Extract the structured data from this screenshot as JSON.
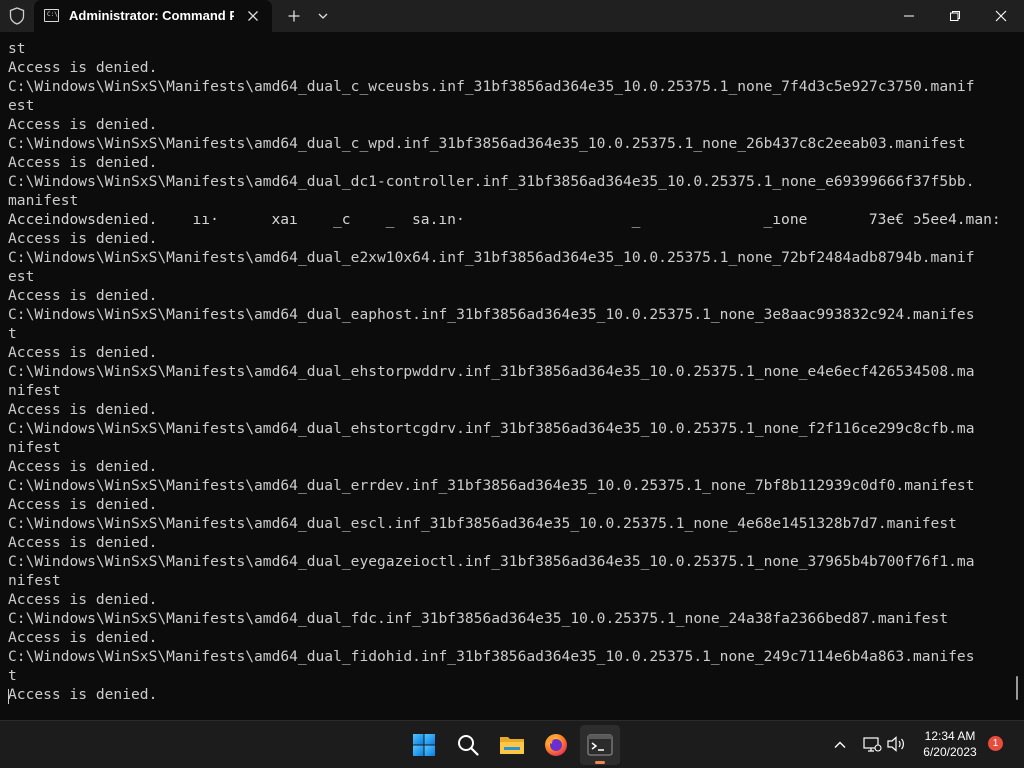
{
  "window": {
    "tab_title": "Administrator:  Command Prompt",
    "tab_icon_text": "C:\\",
    "new_tab_symbol": "+",
    "icons": [
      "shield-icon",
      "cmd-icon",
      "close-tab-icon",
      "new-tab-icon",
      "chevron-down-icon",
      "minimize-icon",
      "maximize-icon",
      "close-icon"
    ]
  },
  "terminal": {
    "lines": [
      "st",
      "Access is denied.",
      "C:\\Windows\\WinSxS\\Manifests\\amd64_dual_c_wceusbs.inf_31bf3856ad364e35_10.0.25375.1_none_7f4d3c5e927c3750.manif",
      "est",
      "Access is denied.",
      "C:\\Windows\\WinSxS\\Manifests\\amd64_dual_c_wpd.inf_31bf3856ad364e35_10.0.25375.1_none_26b437c8c2eeab03.manifest",
      "Access is denied.",
      "C:\\Windows\\WinSxS\\Manifests\\amd64_dual_dc1-controller.inf_31bf3856ad364e35_10.0.25375.1_none_e69399666f37f5bb.",
      "manifest",
      "Acceindowsdenied.    ıı·      ⅹaı    _c    _  sa.ın·                   _              _ıone       73e€ ɔ5ee4.man: es",
      "Access is denied.",
      "C:\\Windows\\WinSxS\\Manifests\\amd64_dual_e2xw10x64.inf_31bf3856ad364e35_10.0.25375.1_none_72bf2484adb8794b.manif",
      "est",
      "Access is denied.",
      "C:\\Windows\\WinSxS\\Manifests\\amd64_dual_eaphost.inf_31bf3856ad364e35_10.0.25375.1_none_3e8aac993832c924.manifes",
      "t",
      "Access is denied.",
      "C:\\Windows\\WinSxS\\Manifests\\amd64_dual_ehstorpwddrv.inf_31bf3856ad364e35_10.0.25375.1_none_e4e6ecf426534508.ma",
      "nifest",
      "Access is denied.",
      "C:\\Windows\\WinSxS\\Manifests\\amd64_dual_ehstortcgdrv.inf_31bf3856ad364e35_10.0.25375.1_none_f2f116ce299c8cfb.ma",
      "nifest",
      "Access is denied.",
      "C:\\Windows\\WinSxS\\Manifests\\amd64_dual_errdev.inf_31bf3856ad364e35_10.0.25375.1_none_7bf8b112939c0df0.manifest",
      "Access is denied.",
      "C:\\Windows\\WinSxS\\Manifests\\amd64_dual_escl.inf_31bf3856ad364e35_10.0.25375.1_none_4e68e1451328b7d7.manifest",
      "Access is denied.",
      "C:\\Windows\\WinSxS\\Manifests\\amd64_dual_eyegazeioctl.inf_31bf3856ad364e35_10.0.25375.1_none_37965b4b700f76f1.ma",
      "nifest",
      "Access is denied.",
      "C:\\Windows\\WinSxS\\Manifests\\amd64_dual_fdc.inf_31bf3856ad364e35_10.0.25375.1_none_24a38fa2366bed87.manifest",
      "Access is denied.",
      "C:\\Windows\\WinSxS\\Manifests\\amd64_dual_fidohid.inf_31bf3856ad364e35_10.0.25375.1_none_249c7114e6b4a863.manifes",
      "t",
      "Access is denied."
    ]
  },
  "taskbar": {
    "apps": [
      "start-icon",
      "search-icon",
      "file-explorer-icon",
      "firefox-icon",
      "terminal-icon"
    ],
    "active_app": "terminal",
    "tray_icons": [
      "chevron-up-icon",
      "network-icon",
      "volume-icon"
    ]
  },
  "clock": {
    "time": "12:34 AM",
    "date": "6/20/2023"
  },
  "notifications": {
    "count": "1"
  },
  "colors": {
    "terminal_bg": "#0c0c0c",
    "terminal_text": "#cccccc",
    "titlebar_bg": "#202020",
    "taskbar_bg": "#1c1c1c",
    "accent_indicator": "#f08a4b",
    "notification_badge": "#e84c3d"
  }
}
